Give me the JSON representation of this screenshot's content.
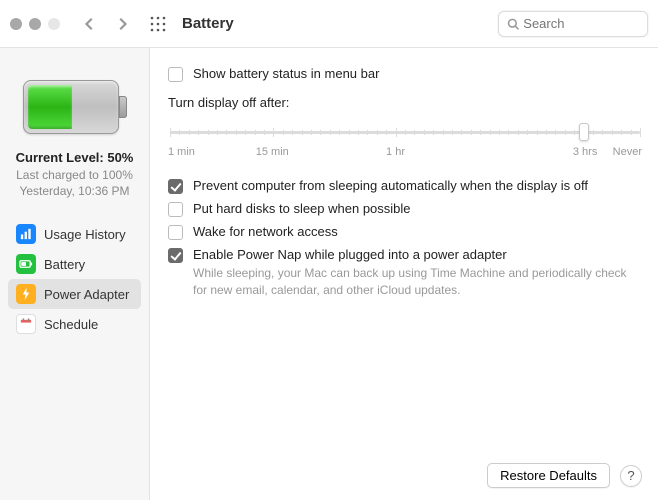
{
  "toolbar": {
    "title": "Battery",
    "search_placeholder": "Search"
  },
  "sidebar": {
    "level_label": "Current Level: 50%",
    "last_charged": "Last charged to 100%",
    "last_charged_time": "Yesterday, 10:36 PM",
    "items": [
      {
        "label": "Usage History",
        "icon": "usage-history-icon",
        "color": "#1887ff"
      },
      {
        "label": "Battery",
        "icon": "battery-icon",
        "color": "#24c140"
      },
      {
        "label": "Power Adapter",
        "icon": "power-adapter-icon",
        "color": "#ffb020"
      },
      {
        "label": "Schedule",
        "icon": "schedule-icon",
        "color": "#ffffff"
      }
    ],
    "selected_index": 2
  },
  "settings": {
    "show_status_label": "Show battery status in menu bar",
    "show_status_checked": false,
    "display_off_label": "Turn display off after:",
    "slider": {
      "ticks": [
        "1 min",
        "15 min",
        "1 hr",
        "3 hrs",
        "Never"
      ],
      "value_position_pct": 88
    },
    "options": [
      {
        "label": "Prevent computer from sleeping automatically when the display is off",
        "checked": true,
        "desc": ""
      },
      {
        "label": "Put hard disks to sleep when possible",
        "checked": false,
        "desc": ""
      },
      {
        "label": "Wake for network access",
        "checked": false,
        "desc": ""
      },
      {
        "label": "Enable Power Nap while plugged into a power adapter",
        "checked": true,
        "desc": "While sleeping, your Mac can back up using Time Machine and periodically check for new email, calendar, and other iCloud updates."
      }
    ]
  },
  "footer": {
    "restore_label": "Restore Defaults",
    "help_label": "?"
  }
}
